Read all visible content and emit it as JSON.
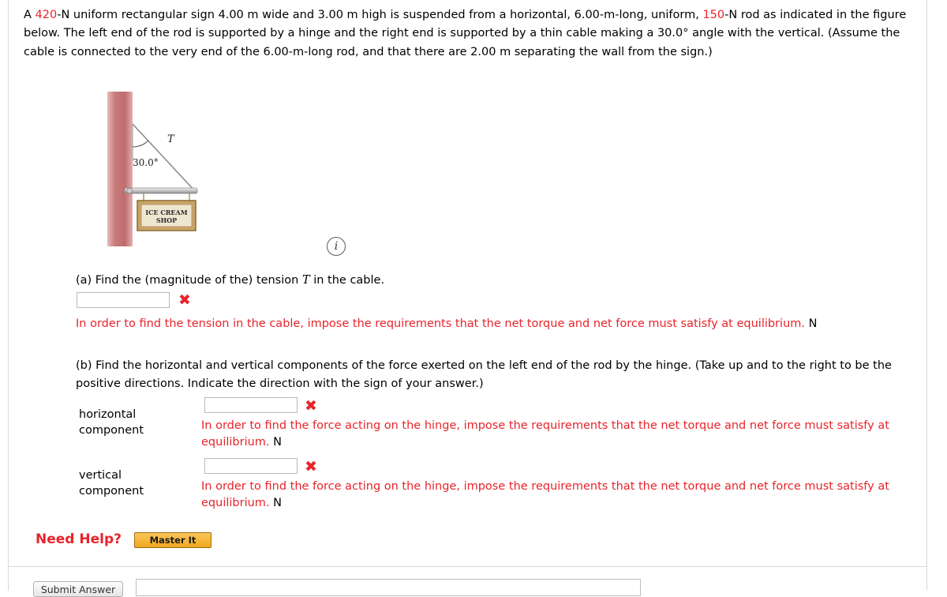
{
  "problem": {
    "segments": [
      {
        "text": "A ",
        "color": "black"
      },
      {
        "text": "420",
        "color": "red"
      },
      {
        "text": "-N uniform rectangular sign 4.00 m wide and 3.00 m high is suspended from a horizontal, 6.00-m-long, uniform, ",
        "color": "black"
      },
      {
        "text": "150",
        "color": "red"
      },
      {
        "text": "-N rod as indicated in the figure below. The left end of the rod is supported by a hinge and the right end is supported by a thin cable making a 30.0° angle with the vertical. (Assume the cable is connected to the very end of the 6.00-m-long rod, and that there are 2.00 m separating the wall from the sign.)",
        "color": "black"
      }
    ]
  },
  "figure": {
    "tension_label": "T",
    "angle_label": "30.0°",
    "sign_line1": "ICE CREAM",
    "sign_line2": "SHOP",
    "info_icon": "i"
  },
  "parts": {
    "a": {
      "prompt_pre": "(a) Find the (magnitude of the) tension ",
      "prompt_var": "T",
      "prompt_post": " in the cable.",
      "input_value": "",
      "mark": "✖",
      "feedback": "In order to find the tension in the cable, impose the requirements that the net torque and net force must satisfy at equilibrium.",
      "unit": "N"
    },
    "b": {
      "prompt": "(b) Find the horizontal and vertical components of the force exerted on the left end of the rod by the hinge. (Take up and to the right to be the positive directions. Indicate the direction with the sign of your answer.)",
      "horizontal_label": "horizontal\ncomponent",
      "horizontal_value": "",
      "horizontal_mark": "✖",
      "horizontal_feedback": "In order to find the force acting on the hinge, impose the requirements that the net torque and net force must satisfy at equilibrium.",
      "horizontal_unit": "N",
      "vertical_label": "vertical\ncomponent",
      "vertical_value": "",
      "vertical_mark": "✖",
      "vertical_feedback": "In order to find the force acting on the hinge, impose the requirements that the net torque and net force must satisfy at equilibrium.",
      "vertical_unit": "N"
    }
  },
  "help": {
    "label": "Need Help?",
    "button": "Master It"
  },
  "footer": {
    "submit_label": "Submit Answer",
    "field_value": ""
  },
  "colors": {
    "accent_red": "#e8232a",
    "wall_red": "#c36a6a",
    "sign_tan": "#c9a469",
    "button_orange": "#f0a81f"
  }
}
